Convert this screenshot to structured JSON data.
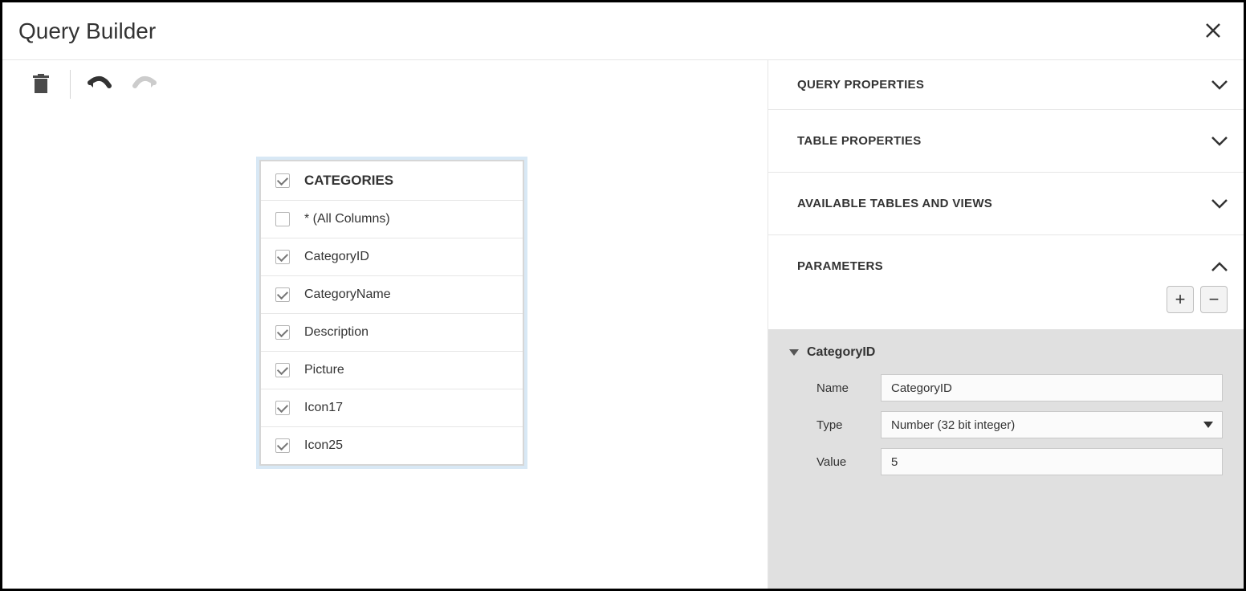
{
  "title": "Query Builder",
  "table": {
    "name": "CATEGORIES",
    "columns": [
      {
        "label": "* (All Columns)",
        "checked": false
      },
      {
        "label": "CategoryID",
        "checked": true
      },
      {
        "label": "CategoryName",
        "checked": true
      },
      {
        "label": "Description",
        "checked": true
      },
      {
        "label": "Picture",
        "checked": true
      },
      {
        "label": "Icon17",
        "checked": true
      },
      {
        "label": "Icon25",
        "checked": true
      }
    ]
  },
  "right_panel": {
    "sections": {
      "query_properties": "QUERY PROPERTIES",
      "table_properties": "TABLE PROPERTIES",
      "available_tables": "AVAILABLE TABLES AND VIEWS",
      "parameters": "PARAMETERS"
    },
    "parameter": {
      "header": "CategoryID",
      "name_label": "Name",
      "name_value": "CategoryID",
      "type_label": "Type",
      "type_value": "Number (32 bit integer)",
      "value_label": "Value",
      "value_value": "5"
    }
  },
  "buttons": {
    "plus": "+",
    "minus": "−"
  }
}
